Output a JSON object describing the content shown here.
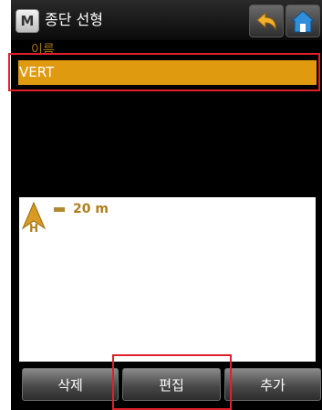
{
  "window": {
    "app_icon_label": "M",
    "title": "종단 선형"
  },
  "toolbar": {
    "back_icon": "back-arrow-icon",
    "home_icon": "home-icon"
  },
  "list": {
    "column_header": "이름",
    "items": [
      {
        "label": "VERT",
        "selected": true
      }
    ]
  },
  "preview": {
    "north_label": "H",
    "scale_text": "20 m"
  },
  "buttons": {
    "delete_label": "삭제",
    "edit_label": "편집",
    "add_label": "추가"
  },
  "colors": {
    "accent": "#e09a10",
    "annotation": "#e0202a"
  }
}
